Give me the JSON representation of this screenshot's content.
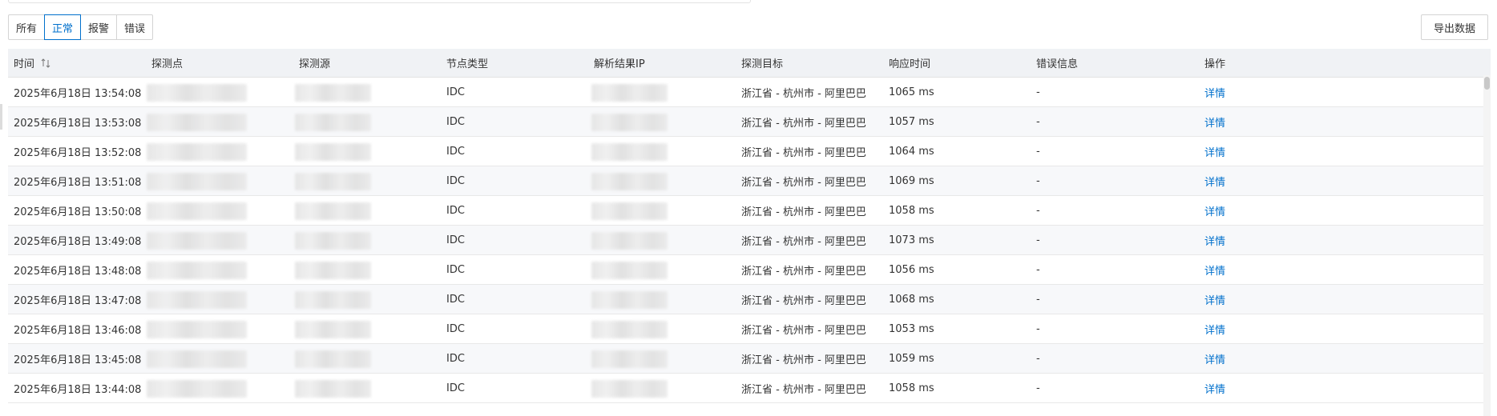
{
  "filters": [
    "所有",
    "正常",
    "报警",
    "错误"
  ],
  "active_filter": "正常",
  "export_label": "导出数据",
  "table": {
    "columns": [
      "时间",
      "探测点",
      "探测源",
      "节点类型",
      "解析结果IP",
      "探测目标",
      "响应时间",
      "错误信息",
      "操作"
    ],
    "rows": [
      {
        "time": "2025年6月18日 13:54:08",
        "node_type": "IDC",
        "target": "浙江省 - 杭州市 - 阿里巴巴",
        "response": "1065 ms",
        "error": "-",
        "action": "详情"
      },
      {
        "time": "2025年6月18日 13:53:08",
        "node_type": "IDC",
        "target": "浙江省 - 杭州市 - 阿里巴巴",
        "response": "1057 ms",
        "error": "-",
        "action": "详情"
      },
      {
        "time": "2025年6月18日 13:52:08",
        "node_type": "IDC",
        "target": "浙江省 - 杭州市 - 阿里巴巴",
        "response": "1064 ms",
        "error": "-",
        "action": "详情"
      },
      {
        "time": "2025年6月18日 13:51:08",
        "node_type": "IDC",
        "target": "浙江省 - 杭州市 - 阿里巴巴",
        "response": "1069 ms",
        "error": "-",
        "action": "详情"
      },
      {
        "time": "2025年6月18日 13:50:08",
        "node_type": "IDC",
        "target": "浙江省 - 杭州市 - 阿里巴巴",
        "response": "1058 ms",
        "error": "-",
        "action": "详情"
      },
      {
        "time": "2025年6月18日 13:49:08",
        "node_type": "IDC",
        "target": "浙江省 - 杭州市 - 阿里巴巴",
        "response": "1073 ms",
        "error": "-",
        "action": "详情"
      },
      {
        "time": "2025年6月18日 13:48:08",
        "node_type": "IDC",
        "target": "浙江省 - 杭州市 - 阿里巴巴",
        "response": "1056 ms",
        "error": "-",
        "action": "详情"
      },
      {
        "time": "2025年6月18日 13:47:08",
        "node_type": "IDC",
        "target": "浙江省 - 杭州市 - 阿里巴巴",
        "response": "1068 ms",
        "error": "-",
        "action": "详情"
      },
      {
        "time": "2025年6月18日 13:46:08",
        "node_type": "IDC",
        "target": "浙江省 - 杭州市 - 阿里巴巴",
        "response": "1053 ms",
        "error": "-",
        "action": "详情"
      },
      {
        "time": "2025年6月18日 13:45:08",
        "node_type": "IDC",
        "target": "浙江省 - 杭州市 - 阿里巴巴",
        "response": "1059 ms",
        "error": "-",
        "action": "详情"
      },
      {
        "time": "2025年6月18日 13:44:08",
        "node_type": "IDC",
        "target": "浙江省 - 杭州市 - 阿里巴巴",
        "response": "1058 ms",
        "error": "-",
        "action": "详情"
      }
    ]
  },
  "colors": {
    "accent": "#0070cc",
    "header_bg": "#f0f2f5",
    "row_alt_bg": "#f7f8fa",
    "border": "#e3e3e3"
  },
  "icons": {
    "sort": "sort-icon"
  }
}
